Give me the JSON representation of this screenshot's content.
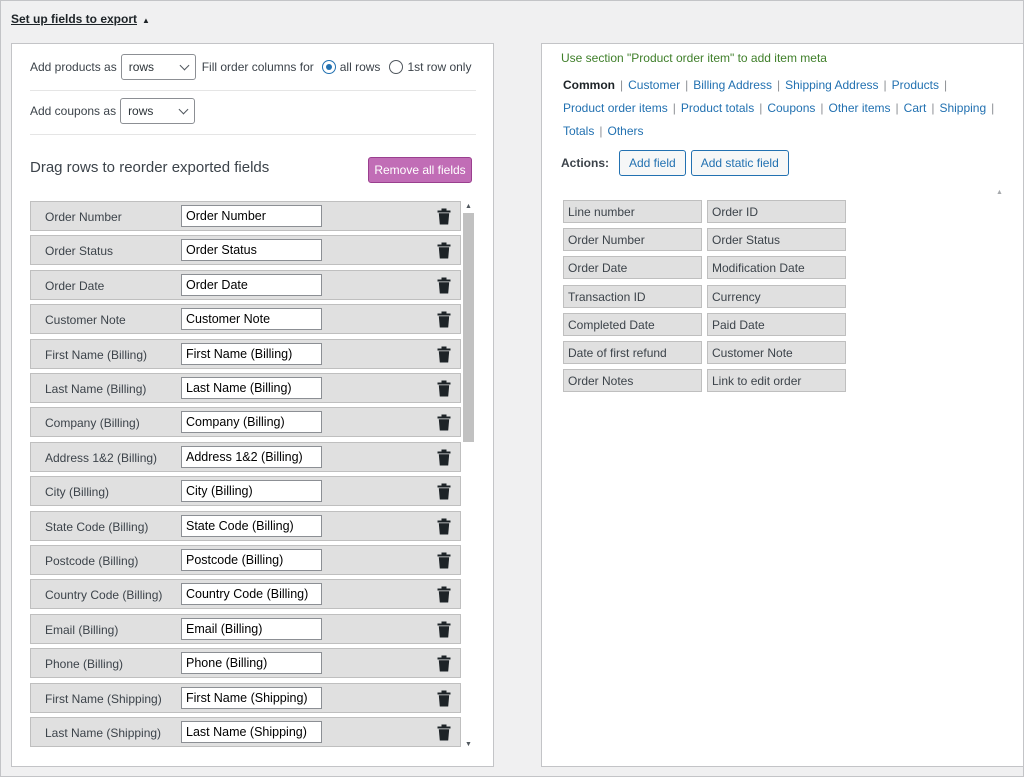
{
  "section": {
    "title": "Set up fields to export",
    "caret": "▲"
  },
  "options": {
    "add_products_label": "Add products as",
    "add_products_value": "rows",
    "fill_order_label": "Fill order columns for",
    "radio_all_rows": "all rows",
    "radio_first_row": "1st row only",
    "add_coupons_label": "Add coupons as",
    "add_coupons_value": "rows"
  },
  "fields_panel": {
    "title": "Drag rows to reorder exported fields",
    "remove_all_label": "Remove all fields",
    "rows": [
      {
        "label": "Order Number",
        "value": "Order Number"
      },
      {
        "label": "Order Status",
        "value": "Order Status"
      },
      {
        "label": "Order Date",
        "value": "Order Date"
      },
      {
        "label": "Customer Note",
        "value": "Customer Note"
      },
      {
        "label": "First Name (Billing)",
        "value": "First Name (Billing)"
      },
      {
        "label": "Last Name (Billing)",
        "value": "Last Name (Billing)"
      },
      {
        "label": "Company (Billing)",
        "value": "Company (Billing)"
      },
      {
        "label": "Address 1&2 (Billing)",
        "value": "Address 1&2 (Billing)"
      },
      {
        "label": "City (Billing)",
        "value": "City (Billing)"
      },
      {
        "label": "State Code (Billing)",
        "value": "State Code (Billing)"
      },
      {
        "label": "Postcode (Billing)",
        "value": "Postcode (Billing)"
      },
      {
        "label": "Country Code (Billing)",
        "value": "Country Code (Billing)"
      },
      {
        "label": "Email (Billing)",
        "value": "Email (Billing)"
      },
      {
        "label": "Phone (Billing)",
        "value": "Phone (Billing)"
      },
      {
        "label": "First Name (Shipping)",
        "value": "First Name (Shipping)"
      },
      {
        "label": "Last Name (Shipping)",
        "value": "Last Name (Shipping)"
      }
    ]
  },
  "available": {
    "hint": "Use section \"Product order item\" to add item meta",
    "categories": [
      "Common",
      "Customer",
      "Billing Address",
      "Shipping Address",
      "Products",
      "Product order items",
      "Product totals",
      "Coupons",
      "Other items",
      "Cart",
      "Shipping",
      "Totals",
      "Others"
    ],
    "active_category": "Common",
    "actions_label": "Actions:",
    "add_field_label": "Add field",
    "add_static_label": "Add static field",
    "items": [
      "Line number",
      "Order ID",
      "Order Number",
      "Order Status",
      "Order Date",
      "Modification Date",
      "Transaction ID",
      "Currency",
      "Completed Date",
      "Paid Date",
      "Date of first refund",
      "Customer Note",
      "Order Notes",
      "Link to edit order"
    ]
  },
  "colors": {
    "accent": "#2271b1",
    "remove_button": "#c16db6",
    "hint_green": "#3f7f2a"
  }
}
